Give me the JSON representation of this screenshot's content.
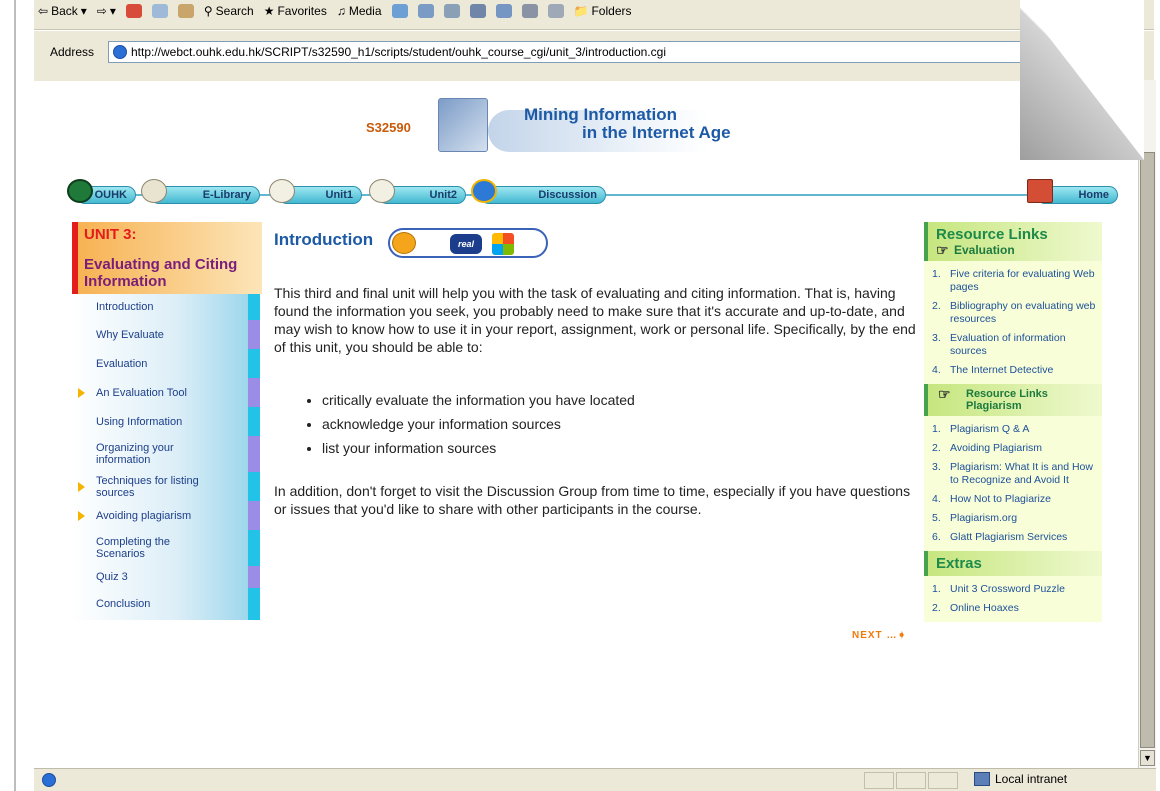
{
  "browser": {
    "toolbar": {
      "back": "Back",
      "search": "Search",
      "favorites": "Favorites",
      "media": "Media",
      "folders": "Folders"
    },
    "address_label": "Address",
    "url": "http://webct.ouhk.edu.hk/SCRIPT/s32590_h1/scripts/student/ouhk_course_cgi/unit_3/introduction.cgi",
    "status_zone": "Local intranet"
  },
  "banner": {
    "course_code": "S32590",
    "title_line1": "Mining Information",
    "title_line2": "in the Internet Age"
  },
  "nav": {
    "items": [
      "OUHK",
      "E-Library",
      "Unit1",
      "Unit2",
      "Discussion"
    ],
    "home": "Home"
  },
  "sidebar": {
    "unit_label": "UNIT 3:",
    "unit_title": "Evaluating and Citing Information",
    "items": [
      {
        "label": "Introduction"
      },
      {
        "label": "Why Evaluate"
      },
      {
        "label": "Evaluation"
      },
      {
        "label": "An Evaluation Tool"
      },
      {
        "label": "Using Information"
      },
      {
        "label": "Organizing your information"
      },
      {
        "label": "Techniques for listing sources"
      },
      {
        "label": "Avoiding plagiarism"
      },
      {
        "label": "Completing the Scenarios"
      },
      {
        "label": "Quiz 3"
      },
      {
        "label": "Conclusion"
      }
    ]
  },
  "main": {
    "title": "Introduction",
    "real_label": "real",
    "paragraph1": "This third and final unit will help you with the task of evaluating and citing information. That is, having found the information you seek, you probably need to make sure that it's accurate and up-to-date, and may wish to know how to use it in your report, assignment, work or personal life. Specifically, by the end of this unit, you should be able to:",
    "bullets": [
      "critically evaluate the information you have located",
      "acknowledge your information sources",
      "list your information sources"
    ],
    "paragraph2": "In addition, don't forget to visit the Discussion Group from time to time, especially if you have questions or issues that you'd like to share with other participants in the course.",
    "next_label": "NEXT"
  },
  "resources": {
    "heading": "Resource Links",
    "sub_evaluation": "Evaluation",
    "evaluation_links": [
      "Five criteria for evaluating Web pages",
      "Bibliography on evaluating web resources",
      "Evaluation of information sources",
      "The Internet Detective"
    ],
    "plagiarism_heading_line1": "Resource Links",
    "plagiarism_heading_line2": "Plagiarism",
    "plagiarism_links": [
      "Plagiarism Q & A",
      "Avoiding Plagiarism",
      "Plagiarism: What It is and How to Recognize and Avoid It",
      "How Not to Plagiarize",
      "Plagiarism.org",
      "Glatt Plagiarism Services"
    ],
    "extras_heading": "Extras",
    "extras_links": [
      "Unit 3 Crossword Puzzle",
      "Online Hoaxes"
    ]
  }
}
